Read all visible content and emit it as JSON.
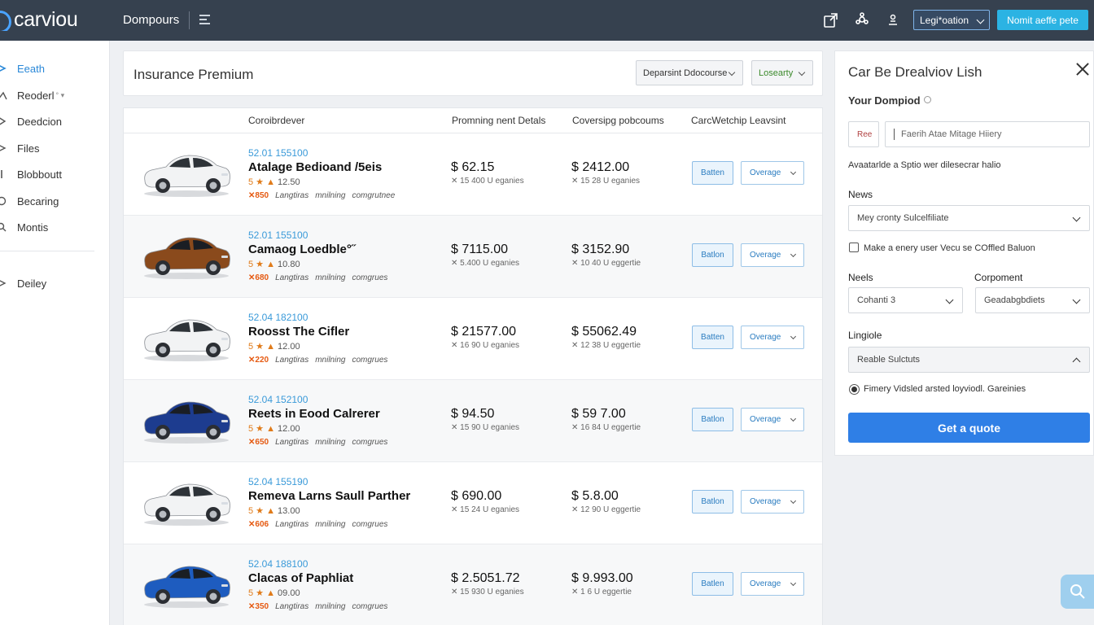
{
  "topbar": {
    "logo": "carviou",
    "nav_label": "Dompours",
    "lang_select": "Legi*oation",
    "cta": "Nomit aeffe pete"
  },
  "sidebar": {
    "items": [
      {
        "label": "Eeath",
        "sub": "",
        "icon": "info-icon"
      },
      {
        "label": "Reoderl",
        "sub": "° ▾",
        "icon": "chart-icon"
      },
      {
        "label": "Deedcion",
        "sub": "",
        "icon": "bolt-icon"
      },
      {
        "label": "Files",
        "sub": "",
        "icon": "file-icon"
      },
      {
        "label": "Blobboutt",
        "sub": "",
        "icon": "box-icon"
      },
      {
        "label": "Becaring",
        "sub": "",
        "icon": "gear-icon"
      },
      {
        "label": "Montis",
        "sub": "",
        "icon": "search-icon"
      },
      {
        "label": "Deiley",
        "sub": "",
        "icon": "settings-icon"
      }
    ]
  },
  "header": {
    "title": "Insurance Premium",
    "filter1": "Deparsint Ddocourse",
    "filter2": "Losearty"
  },
  "table": {
    "columns": [
      "Coroibrdever",
      "Promning nent Detals",
      "Coversipg pobcoums",
      "CarcWetchip Leavsint"
    ],
    "rows": [
      {
        "code": "52.01 155100",
        "name": "Atalage Bedioand /5eis",
        "rating": "12.50",
        "score": "850",
        "tags": [
          "Langtiras",
          "mnilning",
          "comgrutnee"
        ],
        "price1": "$ 62.15",
        "price1_sub": "15 400 U eganies",
        "price2": "$ 2412.00",
        "price2_sub": "15 28 U eganies",
        "btn": "Batten",
        "dropdown": "Overage",
        "color": "#f2f3f4"
      },
      {
        "code": "52.01 155100",
        "name": "Camaog Loedble°˝",
        "rating": "10.80",
        "score": "680",
        "tags": [
          "Langtiras",
          "mnilning",
          "comgrues"
        ],
        "price1": "$ 7115.00",
        "price1_sub": "5.400 U eganies",
        "price2": "$ 3152.90",
        "price2_sub": "10 40 U eggertie",
        "btn": "Batlon",
        "dropdown": "Overage",
        "color": "#8a4a1c"
      },
      {
        "code": "52.04 182100",
        "name": "Roosst The Cifler",
        "rating": "12.00",
        "score": "220",
        "tags": [
          "Langtiras",
          "mnilning",
          "comgrues"
        ],
        "price1": "$ 21577.00",
        "price1_sub": "16 90 U eganies",
        "price2": "$ 55062.49",
        "price2_sub": "12 38 U eggertie",
        "btn": "Batten",
        "dropdown": "Overage",
        "color": "#f2f3f4"
      },
      {
        "code": "52.04 152100",
        "name": "Reets in Eood Calrerer",
        "rating": "12.00",
        "score": "650",
        "tags": [
          "Langtiras",
          "mnilning",
          "comgrues"
        ],
        "price1": "$ 94.50",
        "price1_sub": "15 90 U eganies",
        "price2": "$ 59 7.00",
        "price2_sub": "16 84 U eggertie",
        "btn": "Batlon",
        "dropdown": "Overage",
        "color": "#1d3c8f"
      },
      {
        "code": "52.04 155190",
        "name": "Remeva Larns Saull Parther",
        "rating": "13.00",
        "score": "606",
        "tags": [
          "Langtiras",
          "mnilning",
          "comgrues"
        ],
        "price1": "$ 690.00",
        "price1_sub": "15 24 U eganies",
        "price2": "$ 5.8.00",
        "price2_sub": "12 90 U eggertie",
        "btn": "Batlon",
        "dropdown": "Overage",
        "color": "#f2f3f4"
      },
      {
        "code": "52.04 188100",
        "name": "Clacas of Paphliat",
        "rating": "09.00",
        "score": "350",
        "tags": [
          "Langtiras",
          "mnilning",
          "comgrues"
        ],
        "price1": "$ 2.5051.72",
        "price1_sub": "15 930 U eganies",
        "price2": "$ 9.993.00",
        "price2_sub": "1 6 U eggertie",
        "btn": "Batlen",
        "dropdown": "Overage",
        "color": "#1e5cbf"
      }
    ]
  },
  "panel": {
    "title": "Car Be Drealviov Lish",
    "subtitle": "Your Dompiod",
    "small_input": "Ree",
    "search_placeholder": "Faerih Atae Mitage Hiiery",
    "available_text": "Avaatarlde a Sptio wer dilesecrar halio",
    "news_label": "News",
    "news_select": "Mey cronty Sulcelfiliate",
    "checkbox_text": "Make a enery user Vecu se COffled Baluon",
    "neels_label": "Neels",
    "component_label": "Corpoment",
    "neels_select": "Cohanti 3",
    "component_select": "Geadabgbdiets",
    "lingiole_label": "Lingiole",
    "lingiole_select": "Reable Sulctuts",
    "radio_text": "Fimery Vidsled arsted loyviodl. Gareinies",
    "quote_button": "Get a quote"
  },
  "colors": {
    "topbar": "#36414f",
    "accent": "#2f7fe6",
    "link": "#3a9ad9",
    "cta": "#2bb3e3"
  }
}
